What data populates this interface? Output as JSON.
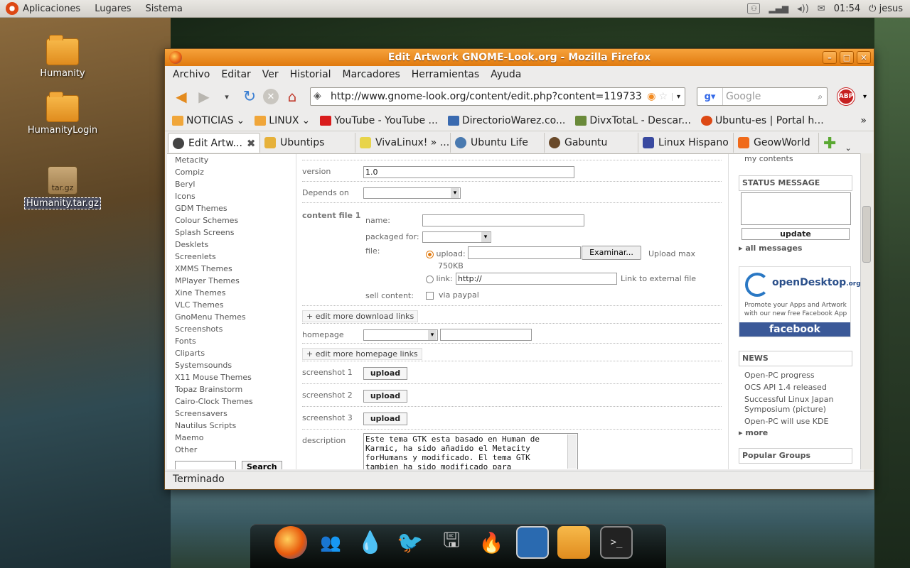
{
  "top_panel": {
    "menus": [
      "Aplicaciones",
      "Lugares",
      "Sistema"
    ],
    "clock": "01:54",
    "user": "jesus"
  },
  "desktop": {
    "icons": [
      {
        "label": "Humanity",
        "kind": "folder"
      },
      {
        "label": "HumanityLogin",
        "kind": "folder"
      },
      {
        "label": "Humanity.tar.gz",
        "kind": "archive",
        "badge": "tar.gz"
      }
    ]
  },
  "window": {
    "title": "Edit Artwork GNOME-Look.org - Mozilla Firefox",
    "menu": [
      "Archivo",
      "Editar",
      "Ver",
      "Historial",
      "Marcadores",
      "Herramientas",
      "Ayuda"
    ],
    "url": "http://www.gnome-look.org/content/edit.php?content=119733",
    "search_placeholder": "Google",
    "abp": "ABP",
    "bookmarks": [
      {
        "label": "NOTICIAS",
        "dropdown": true,
        "color": "#f0a63a"
      },
      {
        "label": "LINUX",
        "dropdown": true,
        "color": "#f0a63a"
      },
      {
        "label": "YouTube - YouTube ...",
        "color": "#d91c1c"
      },
      {
        "label": "DirectorioWarez.co...",
        "color": "#3a6ab0"
      },
      {
        "label": "DivxTotaL - Descar...",
        "color": "#6a8a3a"
      },
      {
        "label": "Ubuntu-es | Portal h...",
        "color": "#dd4814"
      }
    ],
    "tabs": [
      {
        "label": "Edit Artw...",
        "active": true,
        "color": "#444"
      },
      {
        "label": "Ubuntips",
        "color": "#e6b13a"
      },
      {
        "label": "VivaLinux! » ...",
        "color": "#e8d44a"
      },
      {
        "label": "Ubuntu Life",
        "color": "#4a7ab0"
      },
      {
        "label": "Gabuntu",
        "color": "#6a4a2a"
      },
      {
        "label": "Linux Hispano",
        "color": "#3a4aa0"
      },
      {
        "label": "GeowWorld",
        "color": "#f06a1a"
      }
    ],
    "status": "Terminado"
  },
  "page": {
    "categories": [
      "Metacity",
      "Compiz",
      "Beryl",
      "Icons",
      "GDM Themes",
      "Colour Schemes",
      "Splash Screens",
      "Desklets",
      "Screenlets",
      "XMMS Themes",
      "MPlayer Themes",
      "Xine Themes",
      "VLC Themes",
      "GnoMenu Themes",
      "Screenshots",
      "Fonts",
      "Cliparts",
      "Systemsounds",
      "X11 Mouse Themes",
      "Topaz Brainstorm",
      "Cairo-Clock Themes",
      "Screensavers",
      "Nautilus Scripts",
      "Maemo",
      "Other"
    ],
    "search_button": "Search",
    "form": {
      "version_label": "version",
      "version_value": "1.0",
      "depends_label": "Depends on",
      "content_file_label": "content file 1",
      "name_label": "name:",
      "packaged_label": "packaged for:",
      "file_label": "file:",
      "upload_label": "upload:",
      "examinar": "Examinar...",
      "upload_max": "Upload max",
      "upload_max_size": "750KB",
      "link_label": "link:",
      "link_value": "http://",
      "link_external": "Link to external file",
      "sell_label": "sell content:",
      "via_paypal": "via paypal",
      "edit_more_download": "edit more download links",
      "homepage_label": "homepage",
      "edit_more_homepage": "edit more homepage links",
      "screenshot1_label": "screenshot 1",
      "screenshot2_label": "screenshot 2",
      "screenshot3_label": "screenshot 3",
      "upload_button": "upload",
      "description_label": "description",
      "description_text": "Este tema GTK esta basado en Human de Karmic, ha sido añadido el Metacity forHumans y modificado. El tema GTK tambien ha sido modificado para"
    },
    "sidebar": {
      "my_contents": "my contents",
      "status_title": "STATUS MESSAGE",
      "update_button": "update",
      "all_messages": "all messages",
      "od_brand": "openDesktop",
      "od_tld": ".org",
      "od_text": "Promote your Apps and Artwork with our new free Facebook App",
      "facebook": "facebook",
      "news_title": "NEWS",
      "news": [
        "Open-PC progress",
        "OCS API 1.4 released",
        "Successful Linux Japan Symposium (picture)",
        "Open-PC will use KDE"
      ],
      "more": "more",
      "popular_groups": "Popular Groups"
    }
  },
  "dock": {
    "items": [
      "firefox-icon",
      "pidgin-icon",
      "water-icon",
      "gwibber-icon",
      "disk-icon",
      "burner-icon",
      "monitor-icon",
      "home-folder-icon",
      "terminal-icon"
    ]
  }
}
